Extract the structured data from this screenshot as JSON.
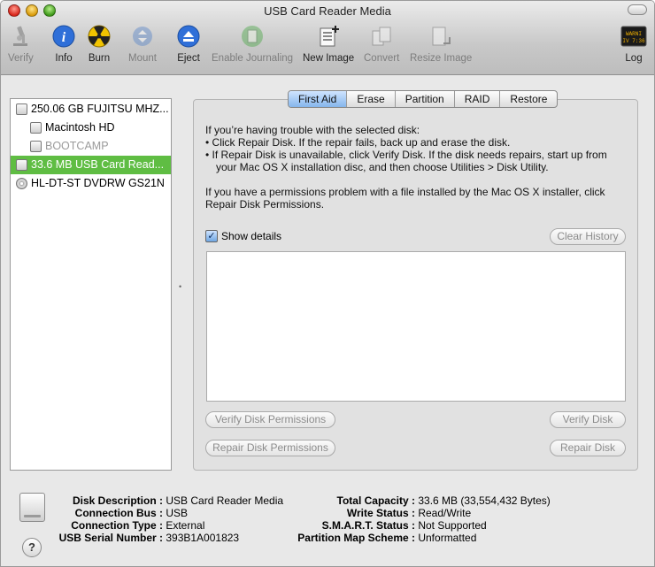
{
  "window": {
    "title": "USB Card Reader Media"
  },
  "toolbar": {
    "verify": "Verify",
    "info": "Info",
    "burn": "Burn",
    "mount": "Mount",
    "eject": "Eject",
    "enable_journaling": "Enable Journaling",
    "new_image": "New Image",
    "convert": "Convert",
    "resize_image": "Resize Image",
    "log": "Log",
    "log_icon_text": "WARNI\nIV 7:36"
  },
  "sidebar": {
    "items": [
      {
        "label": "250.06 GB FUJITSU MHZ...",
        "kind": "disk"
      },
      {
        "label": "Macintosh HD",
        "kind": "volume"
      },
      {
        "label": "BOOTCAMP",
        "kind": "volume"
      },
      {
        "label": "33.6 MB USB Card Read...",
        "kind": "disk",
        "selected": true
      },
      {
        "label": "HL-DT-ST DVDRW GS21N",
        "kind": "optical"
      }
    ]
  },
  "tabs": [
    "First Aid",
    "Erase",
    "Partition",
    "RAID",
    "Restore"
  ],
  "first_aid": {
    "intro": "If you’re having trouble with the selected disk:",
    "bullet1": "• Click Repair Disk. If the repair fails, back up and erase the disk.",
    "bullet2": "• If Repair Disk is unavailable, click Verify Disk. If the disk needs repairs, start up from your Mac OS X installation disc, and then choose Utilities > Disk Utility.",
    "permissions": "If you have a permissions problem with a file installed by the Mac OS X installer, click Repair Disk Permissions.",
    "show_details": "Show details",
    "clear_history": "Clear History",
    "verify_permissions": "Verify Disk Permissions",
    "verify_disk": "Verify Disk",
    "repair_permissions": "Repair Disk Permissions",
    "repair_disk": "Repair Disk"
  },
  "details": {
    "disk_description_label": "Disk Description :",
    "disk_description": "USB Card Reader Media",
    "connection_bus_label": "Connection Bus :",
    "connection_bus": "USB",
    "connection_type_label": "Connection Type :",
    "connection_type": "External",
    "serial_label": "USB Serial Number :",
    "serial": "393B1A001823",
    "total_capacity_label": "Total Capacity :",
    "total_capacity": "33.6 MB (33,554,432 Bytes)",
    "write_status_label": "Write Status :",
    "write_status": "Read/Write",
    "smart_label": "S.M.A.R.T. Status :",
    "smart": "Not Supported",
    "partition_map_label": "Partition Map Scheme :",
    "partition_map": "Unformatted"
  },
  "help_label": "?",
  "colors": {
    "selection": "#5fbd43",
    "tab_active": "#86b6ec"
  }
}
